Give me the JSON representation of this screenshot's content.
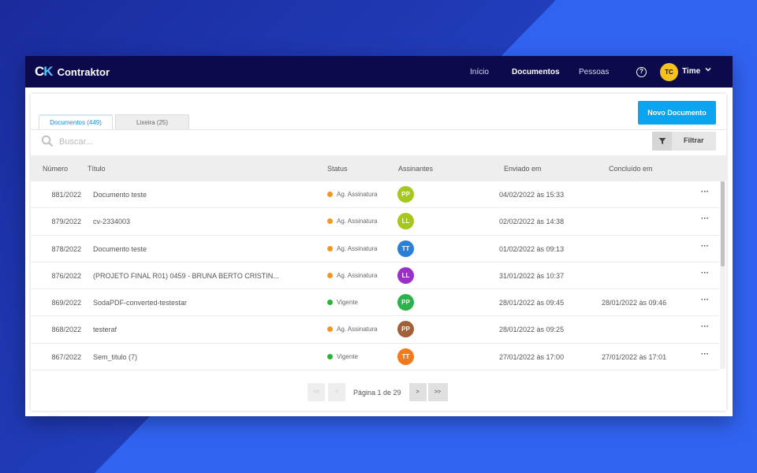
{
  "app": {
    "logo_mark": "CK",
    "logo_text": "Contraktor"
  },
  "nav": {
    "items": [
      "Início",
      "Documentos",
      "Pessoas"
    ],
    "active": "Documentos"
  },
  "user": {
    "initials": "TC",
    "name": "Time",
    "avatar_color": "#f4c21b"
  },
  "actions": {
    "new_document": "Novo Documento",
    "filter": "Filtrar"
  },
  "tabs": [
    {
      "label": "Documentos (449)",
      "active": true
    },
    {
      "label": "Lixeira (25)",
      "active": false
    }
  ],
  "search": {
    "placeholder": "Buscar..."
  },
  "table": {
    "columns": [
      "Número",
      "Título",
      "Status",
      "Assinantes",
      "Enviado em",
      "Concluído em"
    ],
    "rows": [
      {
        "number": "881/2022",
        "title": "Documento teste",
        "status": "Ag. Assinatura",
        "status_color": "#f5961e",
        "signer": "PP",
        "signer_color": "#a5c81e",
        "sent": "04/02/2022 às 15:33",
        "done": ""
      },
      {
        "number": "879/2022",
        "title": "cv-2334003",
        "status": "Ag. Assinatura",
        "status_color": "#f5961e",
        "signer": "LL",
        "signer_color": "#a5c81e",
        "sent": "02/02/2022 às 14:38",
        "done": ""
      },
      {
        "number": "878/2022",
        "title": "Documento teste",
        "status": "Ag. Assinatura",
        "status_color": "#f5961e",
        "signer": "TT",
        "signer_color": "#2c7fd6",
        "sent": "01/02/2022 às 09:13",
        "done": ""
      },
      {
        "number": "876/2022",
        "title": "(PROJETO FINAL R01) 0459 - BRUNA BERTO CRISTIN...",
        "status": "Ag. Assinatura",
        "status_color": "#f5961e",
        "signer": "LL",
        "signer_color": "#9b30c9",
        "sent": "31/01/2022 às 10:37",
        "done": ""
      },
      {
        "number": "869/2022",
        "title": "SodaPDF-converted-testestar",
        "status": "Vigente",
        "status_color": "#29b53a",
        "signer": "PP",
        "signer_color": "#2bb24a",
        "sent": "28/01/2022 às 09:45",
        "done": "28/01/2022 às 09:46"
      },
      {
        "number": "868/2022",
        "title": "testeraf",
        "status": "Ag. Assinatura",
        "status_color": "#f5961e",
        "signer": "PP",
        "signer_color": "#a0613a",
        "sent": "28/01/2022 às 09:25",
        "done": ""
      },
      {
        "number": "867/2022",
        "title": "Sem_titulo (7)",
        "status": "Vigente",
        "status_color": "#29b53a",
        "signer": "TT",
        "signer_color": "#f07a1c",
        "sent": "27/01/2022 às 17:00",
        "done": "27/01/2022 às 17:01"
      }
    ],
    "row_menu": "···"
  },
  "pagination": {
    "first": "<<",
    "prev": "<",
    "label": "Página 1 de 29",
    "next": ">",
    "last": ">>"
  },
  "colors": {
    "topbar": "#0c0a4a",
    "accent": "#0aa4f0",
    "background": "#3163f1"
  }
}
